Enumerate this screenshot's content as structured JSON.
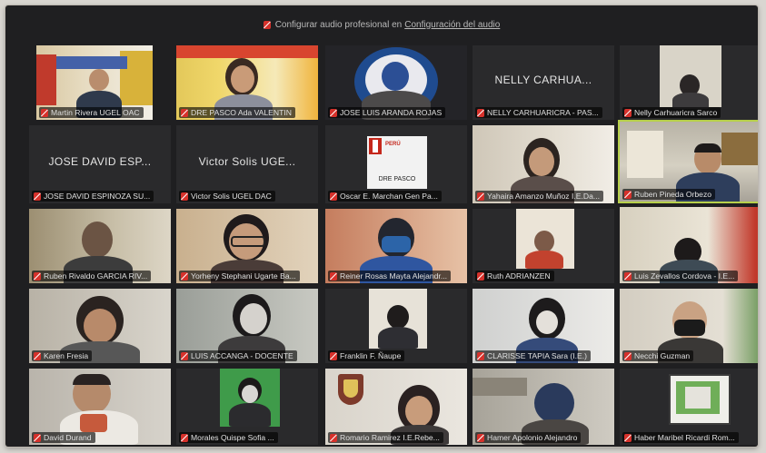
{
  "top_notice": {
    "text": "Configurar audio profesional en",
    "link": "Configuración del audio"
  },
  "participants": [
    {
      "label": "Martin Rivera UGEL OAC"
    },
    {
      "label": "DRE PASCO Ada VALENTIN"
    },
    {
      "label": "JOSE LUIS ARANDA ROJAS"
    },
    {
      "label": "NELLY CARHUARICRA - PAS...",
      "display_name": "NELLY CARHUA..."
    },
    {
      "label": "Nelly Carhuaricra Sarco"
    },
    {
      "label": "JOSE DAVID ESPINOZA SU...",
      "display_name": "JOSE DAVID ESP..."
    },
    {
      "label": "Victor Solis UGEL DAC",
      "display_name": "Victor Solis UGE..."
    },
    {
      "label": "Oscar E. Marchan Gen Pa..."
    },
    {
      "label": "Yahaira Amanzo Muñoz I.E.Da..."
    },
    {
      "label": "Ruben Pineda Orbezo"
    },
    {
      "label": "Ruben Rivaldo GARCIA RIV..."
    },
    {
      "label": "Yorheny Stephani Ugarte Ba..."
    },
    {
      "label": "Reiner Rosas Mayta Alejandr..."
    },
    {
      "label": "Ruth ADRIANZEN"
    },
    {
      "label": "Luis Zevallos Cordova - I.E..."
    },
    {
      "label": "Karen Fresia"
    },
    {
      "label": "LUIS ACCANGA - DOCENTE"
    },
    {
      "label": "Franklin F. Ñaupe"
    },
    {
      "label": "CLARISSE TAPIA Sara (I.E.)"
    },
    {
      "label": "Necchi Guzman"
    },
    {
      "label": "David Durand"
    },
    {
      "label": "Morales Quispe Sofia ..."
    },
    {
      "label": "Romario Ramirez I.E.Rebe..."
    },
    {
      "label": "Hamer Apolonio Alejandro"
    },
    {
      "label": "Haber Maribel Ricardi Rom..."
    }
  ],
  "logo_tile": {
    "caption": "DRE PASCO",
    "brand": "PERÚ"
  },
  "colors": {
    "active_speaker": "#b7d04a",
    "muted_mic": "#d6312b",
    "background": "#1f1f21"
  }
}
